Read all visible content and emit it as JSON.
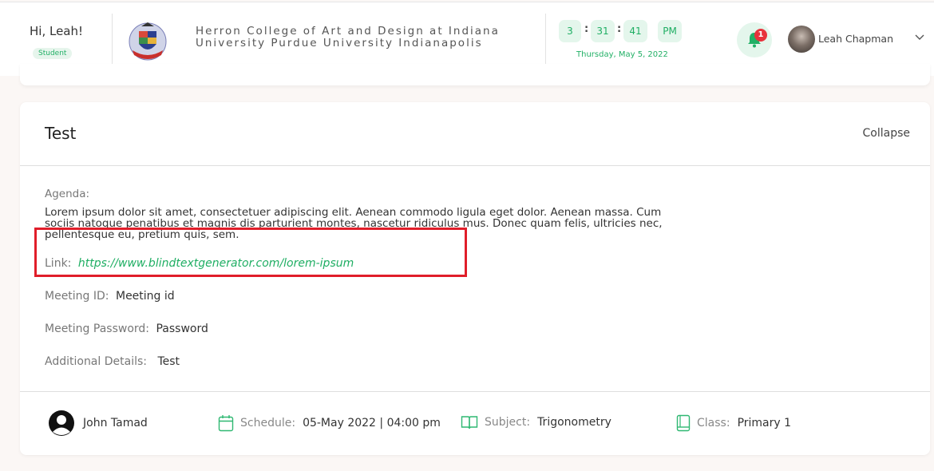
{
  "header": {
    "greeting": "Hi, Leah!",
    "role": "Student",
    "college_line1": "Herron College of Art and Design at Indiana",
    "college_line2": "University Purdue University Indianapolis",
    "clock": {
      "hour": "3",
      "minute": "31",
      "second": "41",
      "ampm": "PM"
    },
    "date": "Thursday, May 5, 2022",
    "notification_count": "1",
    "user_name": "Leah Chapman"
  },
  "meeting": {
    "title": "Test",
    "collapse_label": "Collapse",
    "agenda_label": "Agenda:",
    "agenda_text": "Lorem ipsum dolor sit amet, consectetuer adipiscing elit. Aenean commodo ligula eget dolor. Aenean massa. Cum sociis natoque penatibus et magnis dis parturient montes, nascetur ridiculus mus. Donec quam felis, ultricies nec, pellentesque eu, pretium quis, sem.",
    "link_label": "Link:",
    "link_url": "https://www.blindtextgenerator.com/lorem-ipsum",
    "meeting_id_label": "Meeting ID:",
    "meeting_id": "Meeting id",
    "password_label": "Meeting Password:",
    "password": "Password",
    "details_label": "Additional Details:",
    "details": "Test"
  },
  "footer": {
    "teacher": "John Tamad",
    "schedule_label": "Schedule:",
    "schedule": "05-May 2022 | 04:00 pm",
    "subject_label": "Subject:",
    "subject": "Trigonometry",
    "class_label": "Class:",
    "class": "Primary 1"
  },
  "colors": {
    "accent": "#1fae63",
    "accent_bg": "#e4f6ec",
    "badge_red": "#e8323c",
    "highlight_red": "#e01e2a"
  }
}
